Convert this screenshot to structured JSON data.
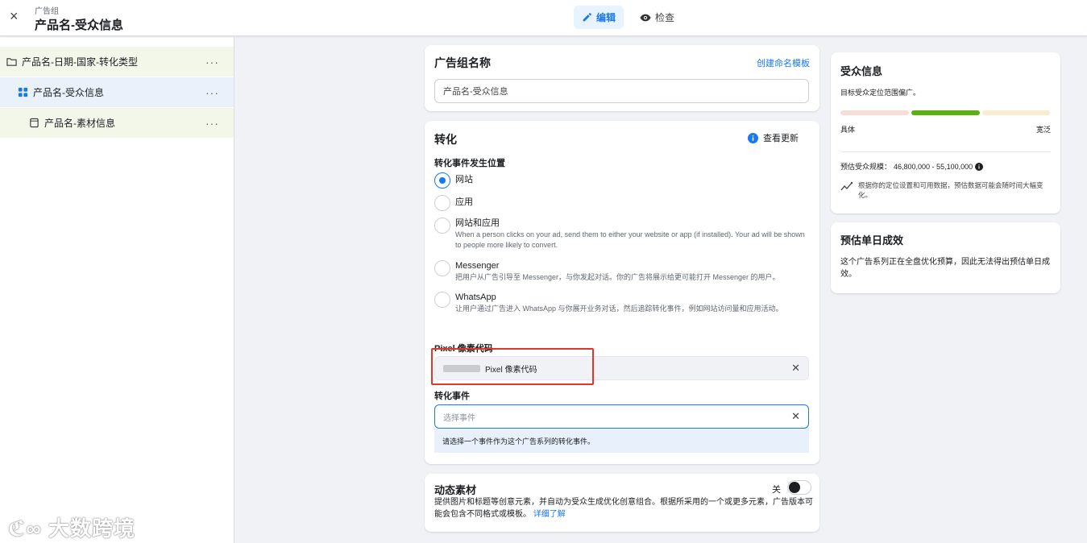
{
  "header": {
    "subtitle": "广告组",
    "title": "产品名-受众信息",
    "close_label": "×",
    "edit_label": "编辑",
    "view_label": "检查"
  },
  "sidebar": {
    "items": [
      {
        "label": "产品名-日期-国家-转化类型",
        "more": "···"
      },
      {
        "label": "产品名-受众信息",
        "more": "···"
      },
      {
        "label": "产品名-素材信息",
        "more": "···"
      }
    ],
    "watermark": "大数跨境"
  },
  "adset_name": {
    "title": "广告组名称",
    "template_link": "创建命名模板",
    "value": "产品名-受众信息"
  },
  "conversion": {
    "title": "转化",
    "updates_link": "查看更新",
    "location_label": "转化事件发生位置",
    "options": [
      {
        "label": "网站",
        "desc": "",
        "selected": true
      },
      {
        "label": "应用",
        "desc": "",
        "selected": false
      },
      {
        "label": "网站和应用",
        "desc": "When a person clicks on your ad, send them to either your website or app (if installed). Your ad will be shown to people more likely to convert.",
        "selected": false
      },
      {
        "label": "Messenger",
        "desc": "把用户从广告引导至 Messenger，与你发起对话。你的广告将展示给更可能打开 Messenger 的用户。",
        "selected": false
      },
      {
        "label": "WhatsApp",
        "desc": "让用户通过广告进入 WhatsApp 与你展开业务对话，然后追踪转化事件，例如网站访问量和应用活动。",
        "selected": false
      }
    ],
    "pixel_label": "Pixel 像素代码",
    "pixel_value": "Pixel 像素代码",
    "event_label": "转化事件",
    "event_placeholder": "选择事件",
    "event_hint": "请选择一个事件作为这个广告系列的转化事件。"
  },
  "dynamic": {
    "title": "动态素材",
    "toggle_label": "关",
    "desc": "提供图片和标题等创意元素，并自动为受众生成优化创意组合。根据所采用的一个或更多元素，广告版本可能会包含不同格式或模板。",
    "learn_more": "详细了解"
  },
  "audience": {
    "title": "受众信息",
    "subtitle": "目标受众定位范围偏广。",
    "specific": "具体",
    "broad": "宽泛",
    "size_label": "预估受众规模：",
    "size_value": "46,800,000 - 55,100,000",
    "note": "根据你的定位设置和可用数据，预估数据可能会随时间大幅变化。"
  },
  "estimate": {
    "title": "预估单日成效",
    "desc": "这个广告系列正在全盘优化预算，因此无法得出预估单日成效。"
  },
  "colors": {
    "accent": "#1877f2",
    "highlight_box": "#e0362c",
    "bar_good": "#5ab30d",
    "bar_left": "#f8dcd8",
    "bar_right": "#f9ecd2"
  }
}
